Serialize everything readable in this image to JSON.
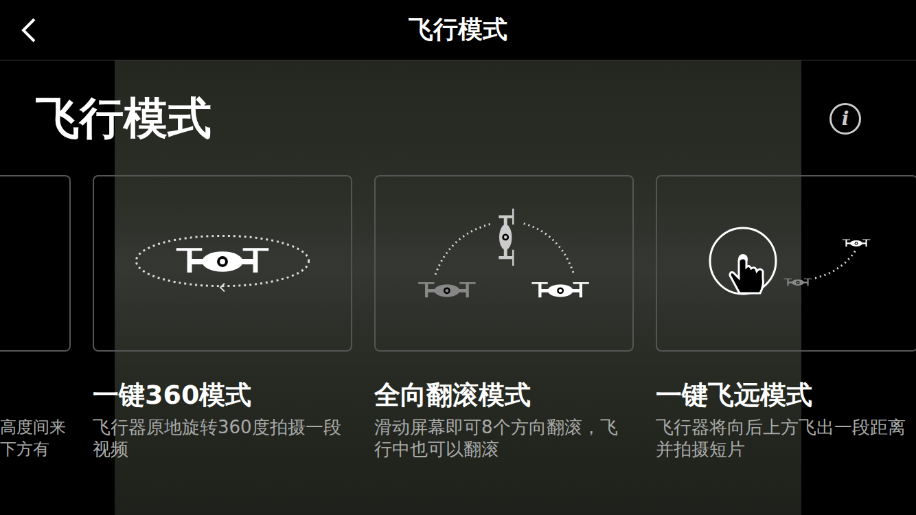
{
  "header": {
    "title": "飞行模式"
  },
  "page_title": "飞行模式",
  "info": "i",
  "modes": [
    {
      "kind": "partial",
      "title": "",
      "description": "",
      "lines": [
        "高度间来",
        "下方有"
      ]
    },
    {
      "kind": "orbit",
      "title": "一键360模式",
      "description": "飞行器原地旋转360度拍摄一段视频",
      "lines": []
    },
    {
      "kind": "flip",
      "title": "全向翻滚模式",
      "description": "滑动屏幕即可8个方向翻滚，飞行中也可以翻滚",
      "lines": []
    },
    {
      "kind": "launch",
      "title": "一键飞远模式",
      "description": "飞行器将向后上方飞出一段距离并拍摄短片",
      "lines": []
    }
  ]
}
